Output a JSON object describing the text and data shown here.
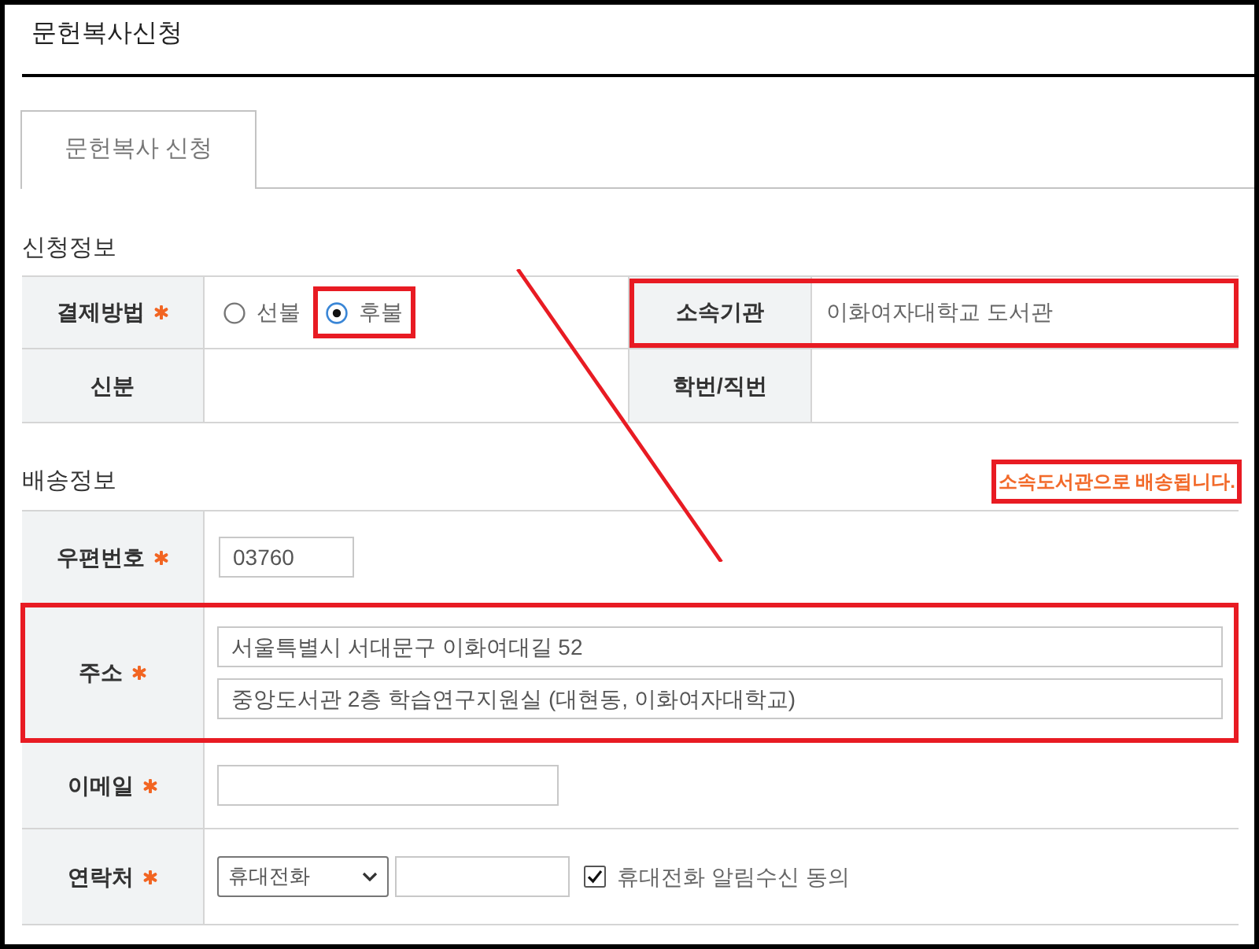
{
  "page_title": "문헌복사신청",
  "tabs": [
    {
      "label": "문헌복사 신청",
      "selected": true
    }
  ],
  "sections": [
    {
      "kind": "info",
      "heading": "신청정보",
      "rows": [
        {
          "cells": [
            {
              "label": "결제방법",
              "required": true,
              "highlighted": false,
              "kind": "radio",
              "options": [
                {
                  "label": "선불",
                  "selected": false,
                  "highlighted": false
                },
                {
                  "label": "후불",
                  "selected": true,
                  "highlighted": true
                }
              ]
            },
            {
              "label": "소속기관",
              "required": false,
              "highlighted": true,
              "kind": "text",
              "value": "이화여자대학교 도서관"
            }
          ]
        },
        {
          "cells": [
            {
              "label": "신분",
              "required": false,
              "highlighted": false,
              "kind": "text"
            },
            {
              "label": "학번/직번",
              "required": false,
              "highlighted": false,
              "kind": "text"
            }
          ]
        }
      ]
    },
    {
      "kind": "delivery",
      "heading": "배송정보",
      "notice": {
        "text": "소속도서관으로 배송됩니다.",
        "highlighted": true
      },
      "rows": [
        {
          "cells": [
            {
              "label": "우편번호",
              "required": true,
              "highlighted": false,
              "kind": "postal",
              "fields": [
                {
                  "kind": "text",
                  "value": "03760"
                }
              ]
            }
          ]
        },
        {
          "cells": [
            {
              "label": "주소",
              "required": true,
              "highlighted": true,
              "kind": "address",
              "fields": [
                {
                  "kind": "text",
                  "value": "서울특별시 서대문구 이화여대길 52"
                },
                {
                  "kind": "text",
                  "value": "중앙도서관 2층 학습연구지원실 (대현동, 이화여자대학교)"
                }
              ]
            }
          ]
        },
        {
          "cells": [
            {
              "label": "이메일",
              "required": true,
              "highlighted": false,
              "kind": "email",
              "fields": [
                {
                  "kind": "text"
                }
              ]
            }
          ]
        },
        {
          "cells": [
            {
              "label": "연락처",
              "required": true,
              "highlighted": false,
              "kind": "contact",
              "fields": [
                {
                  "kind": "select",
                  "value": "휴대전화"
                },
                {
                  "kind": "text"
                },
                {
                  "kind": "checkbox",
                  "label": "휴대전화 알림수신 동의",
                  "checked": true
                }
              ]
            }
          ]
        }
      ]
    }
  ],
  "connector": true
}
